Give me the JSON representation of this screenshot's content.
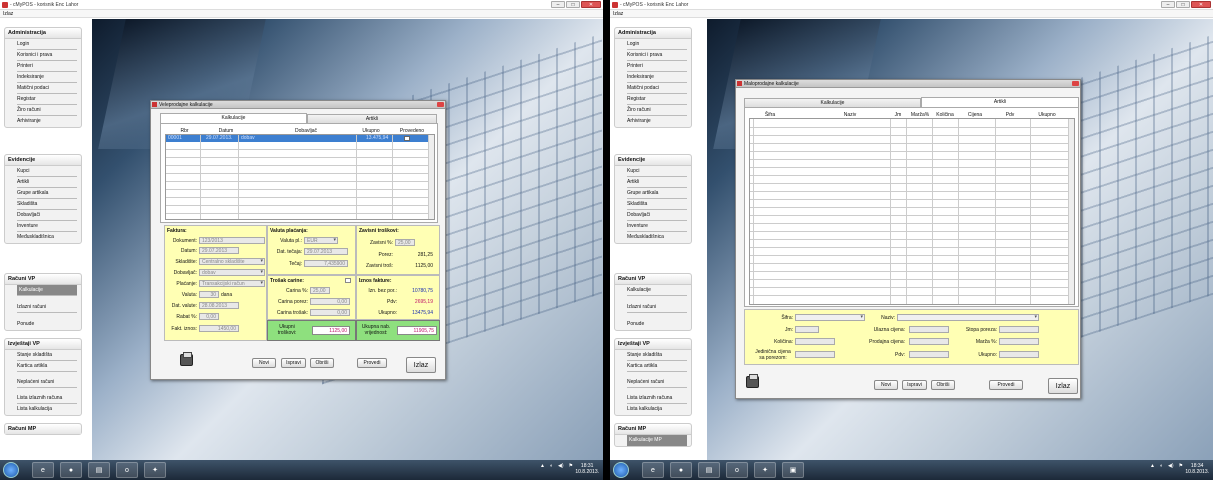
{
  "window": {
    "title": "- cMyPOS - korisnik Enc Lahor",
    "menu_exit": "Izlaz"
  },
  "sidebar": {
    "groups": [
      {
        "title": "Administracija",
        "items": [
          "Login",
          "Korisnici i prava",
          "Printeri",
          "Indeksiranje",
          "Matični podaci",
          "Registar",
          "Žiro računi",
          "Arhiviranje"
        ]
      },
      {
        "title": "Evidencije",
        "items": [
          "Kupci",
          "Artikli",
          "Grupe artikala",
          "Skladišta",
          "Dobavljači",
          "Inventure",
          "Međuskladišnica"
        ]
      },
      {
        "title": "Računi VP",
        "items": [
          "Kalkulacije",
          "Izlazni računi",
          "Ponude"
        ]
      },
      {
        "title": "Izvještaji VP",
        "items": [
          "Stanje skladišta",
          "Kartica artikla",
          "Neplaćeni računi",
          "Lista izlaznih računa",
          "Lista kalkulacija"
        ]
      },
      {
        "title": "Računi MP",
        "items": [
          "Kalkulacije MP"
        ]
      }
    ]
  },
  "dialog1": {
    "title": "Veleprodajne kalkulacije",
    "tabs": [
      "Kalkulacije",
      "Artikli"
    ],
    "columns": [
      "Rbr",
      "Datum",
      "Dobavljač",
      "Ukupno",
      "Provedeno"
    ],
    "row": {
      "rbr": "00001",
      "datum": "29.07.2013.",
      "dobavljac": "dobav",
      "ukupno": "13.475,94"
    },
    "faktura": {
      "title": "Faktura:",
      "dokument_lbl": "Dokument:",
      "dokument": "123/2013",
      "datum_lbl": "Datum:",
      "datum": "29.07.2013",
      "skladiste_lbl": "Skladište:",
      "skladiste": "Centralno skladište",
      "dobavljac_lbl": "Dobavljač:",
      "dobavljac": "dobav",
      "placanje_lbl": "Plaćanje:",
      "placanje": "Transakcijski račun",
      "valuta_lbl": "Valuta:",
      "valuta": "30",
      "dana": "dana",
      "dat_valute_lbl": "Dat. valute:",
      "dat_valute": "28.08.2013",
      "rabat_lbl": "Rabat %:",
      "rabat": "0,00",
      "fakt_iznos_lbl": "Fakt. iznos:",
      "fakt_iznos": "1450,00"
    },
    "valuta": {
      "title": "Valuta plaćanja:",
      "valuta_pl_lbl": "Valuta pl.:",
      "valuta_pl": "EUR",
      "dat_tecaja_lbl": "Dat. tečaja:",
      "dat_tecaja": "29.07.2013",
      "tecaj_lbl": "Tečaj:",
      "tecaj": "7,435900"
    },
    "carina": {
      "title": "Trošak carine:",
      "carina_pct_lbl": "Carina %:",
      "carina_pct": "25,00",
      "carina_porez_lbl": "Carina porez:",
      "carina_porez": "0,00",
      "carina_trosak_lbl": "Carina trošak:",
      "carina_trosak": "0,00"
    },
    "zavisni": {
      "title": "Zavisni troškovi:",
      "zavisni_pct_lbl": "Zavisni %:",
      "zavisni_pct": "25,00",
      "porez_lbl": "Porez:",
      "porez": "281,25",
      "zavisni_tros_lbl": "Zavisni troš:",
      "zavisni_tros": "1125,00"
    },
    "iznos": {
      "title": "Iznos fakture:",
      "bez_por_lbl": "Izn. bez por.:",
      "bez_por": "10780,75",
      "pdv_lbl": "Pdv:",
      "pdv": "2695,19",
      "ukupno_lbl": "Ukupno:",
      "ukupno": "13475,94"
    },
    "ukupni_troskovi_lbl": "Ukupni troškovi:",
    "ukupni_troskovi": "1125,00",
    "ukupna_nab_lbl": "Ukupna nab. vrijednost:",
    "ukupna_nab": "11905,75",
    "buttons": {
      "novi": "Novi",
      "ispravi": "Ispravi",
      "obrisi": "Obriši",
      "provedi": "Provedi",
      "izlaz": "Izlaz"
    }
  },
  "dialog2": {
    "title": "Maloprodajne kalkulacije",
    "tabs": [
      "Kalkulacije",
      "Artikli"
    ],
    "columns": [
      "Šifra",
      "Naziv",
      "Jm",
      "Marža%",
      "Količina",
      "Cijena",
      "Pdv",
      "Ukupno"
    ],
    "form": {
      "sifra": "Šifra:",
      "naziv": "Naziv:",
      "jm": "Jm:",
      "ulazna": "Ulazna cijena:",
      "stopa": "Stopa poreza:",
      "kolicina": "Količina:",
      "prodajna": "Prodajna cijena:",
      "marza": "Marža %:",
      "jedinicna": "Jedinična cijena sa porezom:",
      "pdv": "Pdv:",
      "ukupno": "Ukupno:"
    },
    "buttons": {
      "novi": "Novi",
      "ispravi": "Ispravi",
      "obrisi": "Obriši",
      "provedi": "Provedi",
      "izlaz": "Izlaz"
    }
  },
  "taskbar": {
    "clock1_time": "18:31",
    "clock1_date": "10.8.2013.",
    "clock2_time": "18:34",
    "clock2_date": "10.8.2013."
  }
}
